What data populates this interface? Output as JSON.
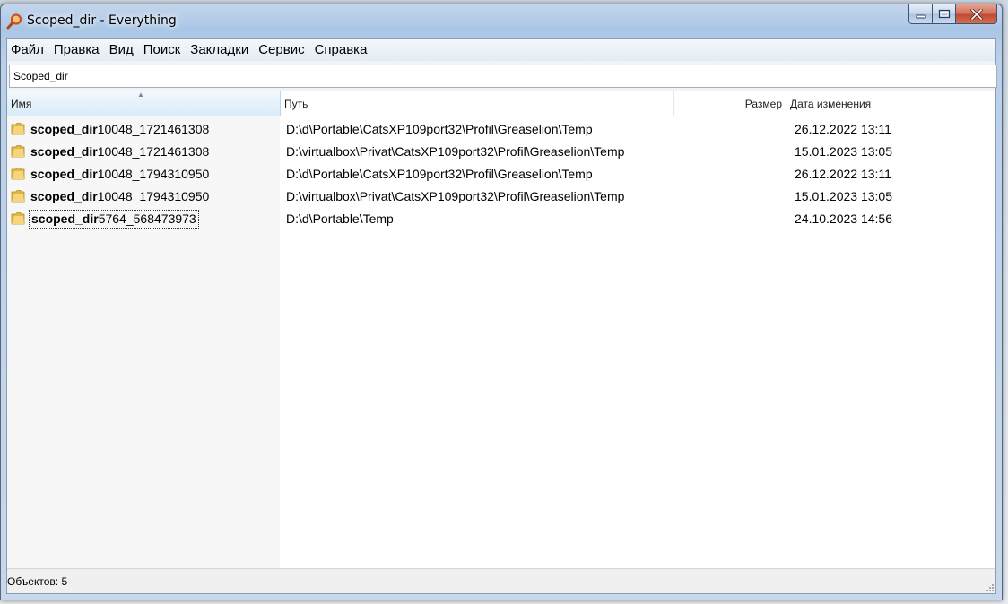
{
  "window": {
    "title": "Scoped_dir - Everything"
  },
  "menu": [
    "Файл",
    "Правка",
    "Вид",
    "Поиск",
    "Закладки",
    "Сервис",
    "Справка"
  ],
  "search": {
    "value": "Scoped_dir"
  },
  "columns": {
    "name": "Имя",
    "path": "Путь",
    "size": "Размер",
    "date": "Дата изменения"
  },
  "rows": [
    {
      "match": "scoped_dir",
      "rest": "10048_1721461308",
      "path": "D:\\d\\Portable\\CatsXP109port32\\Profil\\Greaselion\\Temp",
      "date": "26.12.2022 13:11"
    },
    {
      "match": "scoped_dir",
      "rest": "10048_1721461308",
      "path": "D:\\virtualbox\\Privat\\CatsXP109port32\\Profil\\Greaselion\\Temp",
      "date": "15.01.2023 13:05"
    },
    {
      "match": "scoped_dir",
      "rest": "10048_1794310950",
      "path": "D:\\d\\Portable\\CatsXP109port32\\Profil\\Greaselion\\Temp",
      "date": "26.12.2022 13:11"
    },
    {
      "match": "scoped_dir",
      "rest": "10048_1794310950",
      "path": "D:\\virtualbox\\Privat\\CatsXP109port32\\Profil\\Greaselion\\Temp",
      "date": "15.01.2023 13:05"
    },
    {
      "match": "scoped_dir",
      "rest": "5764_568473973",
      "path": "D:\\d\\Portable\\Temp",
      "date": "24.10.2023 14:56"
    }
  ],
  "status": {
    "text": "Объектов: 5"
  },
  "colors": {
    "header_selected": "#d9ecf9",
    "name_column_bg": "#f7f7f7",
    "folder": "#e8c25a"
  }
}
